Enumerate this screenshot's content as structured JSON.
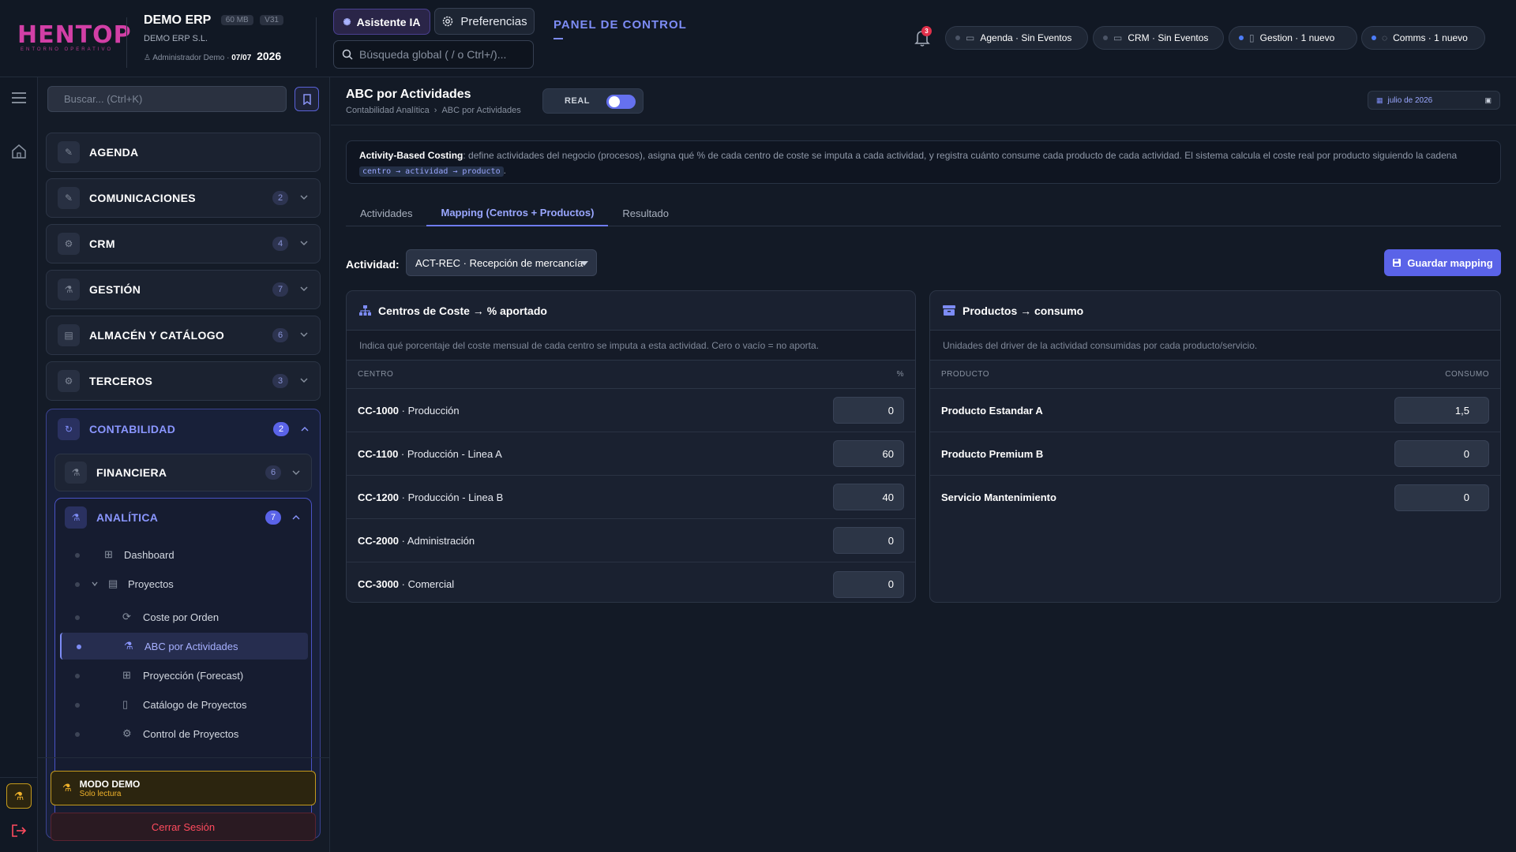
{
  "header": {
    "logo_text": "HENTOP",
    "logo_sub": "ENTORNO OPERATIVO",
    "company_name": "DEMO ERP",
    "storage_badge": "60 MB",
    "version_badge": "V31",
    "company_legal": "DEMO ERP S.L.",
    "user_name": "Administrador Demo",
    "date_short": "07/07",
    "year": "2026",
    "ai_button": "Asistente IA",
    "prefs_button": "Preferencias",
    "global_search_placeholder": "Búsqueda global ( / o Ctrl+/)...",
    "panel_title": "PANEL DE CONTROL",
    "notification_count": "3",
    "chips": [
      {
        "label": "Agenda · Sin Eventos",
        "dot_color": "#4b5466",
        "icon": "calendar-icon"
      },
      {
        "label": "CRM · Sin Eventos",
        "dot_color": "#4b5466",
        "icon": "crm-icon"
      },
      {
        "label": "Gestion · 1 nuevo",
        "dot_color": "#4c7cf7",
        "icon": "document-icon"
      },
      {
        "label": "Comms · 1 nuevo",
        "dot_color": "#4c7cf7",
        "icon": "chat-icon"
      }
    ]
  },
  "sidebar": {
    "search_placeholder": "Buscar... (Ctrl+K)",
    "items": [
      {
        "label": "AGENDA",
        "badge": ""
      },
      {
        "label": "COMUNICACIONES",
        "badge": "2"
      },
      {
        "label": "CRM",
        "badge": "4"
      },
      {
        "label": "GESTIÓN",
        "badge": "7"
      },
      {
        "label": "ALMACÉN Y CATÁLOGO",
        "badge": "6"
      },
      {
        "label": "TERCEROS",
        "badge": "3"
      }
    ],
    "contabilidad": {
      "label": "CONTABILIDAD",
      "badge": "2"
    },
    "financiera": {
      "label": "FINANCIERA",
      "badge": "6"
    },
    "analitica": {
      "label": "ANALÍTICA",
      "badge": "7"
    },
    "tree": [
      {
        "label": "Dashboard"
      },
      {
        "label": "Proyectos"
      },
      {
        "label": "Coste por Orden"
      },
      {
        "label": "ABC por Actividades"
      },
      {
        "label": "Proyección (Forecast)"
      },
      {
        "label": "Catálogo de Proyectos"
      },
      {
        "label": "Control de Proyectos"
      }
    ],
    "demo_title": "MODO DEMO",
    "demo_sub": "Solo lectura",
    "logout": "Cerrar Sesión"
  },
  "page": {
    "title": "ABC por Actividades",
    "breadcrumb_1": "Contabilidad Analítica",
    "breadcrumb_sep": "›",
    "breadcrumb_2": "ABC por Actividades",
    "toggle_label": "REAL",
    "toggle_on": true,
    "date_label": "julio de 2026",
    "info_bold": "Activity-Based Costing",
    "info_text": ": define actividades del negocio (procesos), asigna qué % de cada centro de coste se imputa a cada actividad, y registra cuánto consume cada producto de cada actividad. El sistema calcula el coste real por producto siguiendo la cadena ",
    "info_code": "centro → actividad → producto",
    "info_end": ".",
    "tabs": [
      {
        "label": "Actividades"
      },
      {
        "label": "Mapping (Centros + Productos)"
      },
      {
        "label": "Resultado"
      }
    ],
    "activity_label": "Actividad:",
    "activity_value": "ACT-REC · Recepción de mercancía",
    "save_button": "Guardar mapping"
  },
  "centros": {
    "title": "Centros de Coste → % aportado",
    "desc": "Indica qué porcentaje del coste mensual de cada centro se imputa a esta actividad. Cero o vacío = no aporta.",
    "col_1": "CENTRO",
    "col_2": "%",
    "rows": [
      {
        "code": "CC-1000",
        "name": " · Producción",
        "value": "0"
      },
      {
        "code": "CC-1100",
        "name": " · Producción - Linea A",
        "value": "60"
      },
      {
        "code": "CC-1200",
        "name": " · Producción - Linea B",
        "value": "40"
      },
      {
        "code": "CC-2000",
        "name": " · Administración",
        "value": "0"
      },
      {
        "code": "CC-3000",
        "name": " · Comercial",
        "value": "0"
      }
    ]
  },
  "productos": {
    "title": "Productos → consumo",
    "desc": "Unidades del driver de la actividad consumidas por cada producto/servicio.",
    "col_1": "PRODUCTO",
    "col_2": "CONSUMO",
    "rows": [
      {
        "name": "Producto Estandar A",
        "value": "1,5"
      },
      {
        "name": "Producto Premium B",
        "value": "0"
      },
      {
        "name": "Servicio Mantenimiento",
        "value": "0"
      }
    ]
  }
}
